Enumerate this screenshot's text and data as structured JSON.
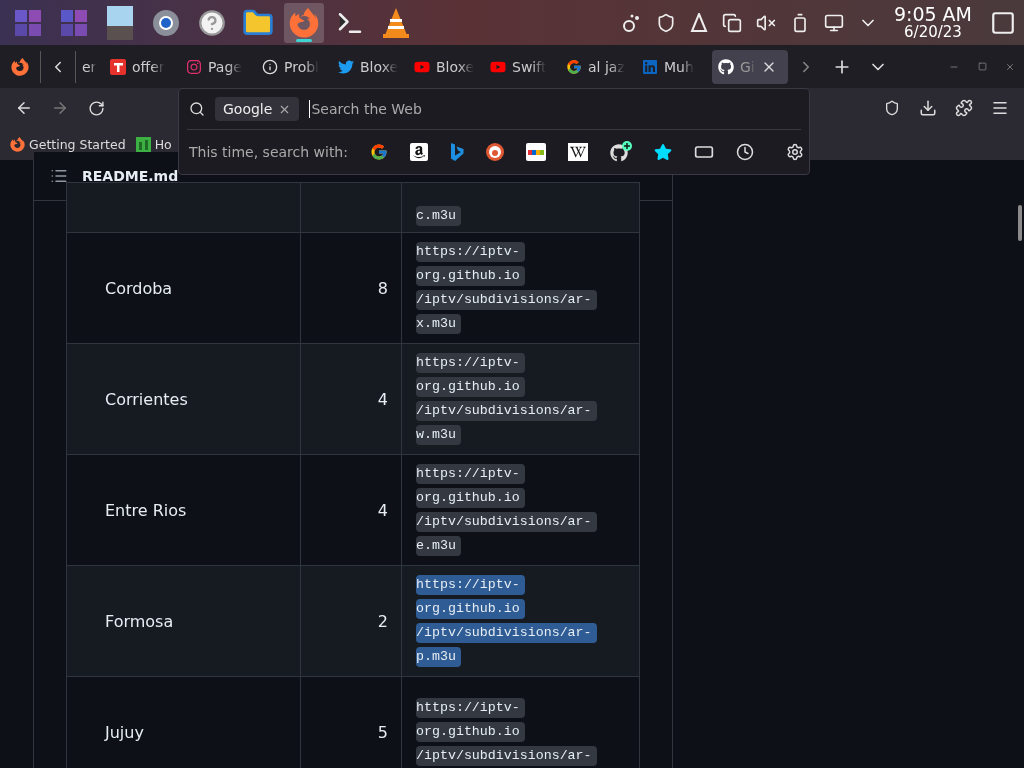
{
  "taskbar": {
    "apps": [
      {
        "active": false
      },
      {
        "active": false
      },
      {
        "active": false
      },
      {
        "active": false
      },
      {
        "active": false
      },
      {
        "active": false
      },
      {
        "active": true
      },
      {
        "active": false
      },
      {
        "active": false
      }
    ],
    "time": "9:05 AM",
    "date": "6/20/23"
  },
  "tabs": {
    "partial_label": "er",
    "items": [
      {
        "label": "offer",
        "selected": false
      },
      {
        "label": "Page",
        "selected": false
      },
      {
        "label": "Probl",
        "selected": false
      },
      {
        "label": "Bloxe",
        "selected": false
      },
      {
        "label": "Bloxe",
        "selected": false
      },
      {
        "label": "Swift",
        "selected": false
      },
      {
        "label": "al jaz",
        "selected": false
      },
      {
        "label": "Muh",
        "selected": false
      },
      {
        "label": "Gi",
        "selected": true
      }
    ]
  },
  "bookmarks": [
    "Getting Started",
    "Ho"
  ],
  "search": {
    "engine_chip": "Google",
    "placeholder": "Search the Web",
    "one_off_label": "This time, search with:"
  },
  "readme": {
    "title": "README.md",
    "rows": [
      {
        "name": "",
        "count": "",
        "url_lines": [
          "c.m3u"
        ],
        "selected": false
      },
      {
        "name": "Cordoba",
        "count": "8",
        "url_lines": [
          "https://iptv-",
          "org.github.io",
          "/iptv/subdivisions/ar-",
          "x.m3u"
        ],
        "selected": false
      },
      {
        "name": "Corrientes",
        "count": "4",
        "url_lines": [
          "https://iptv-",
          "org.github.io",
          "/iptv/subdivisions/ar-",
          "w.m3u"
        ],
        "selected": false
      },
      {
        "name": "Entre Rios",
        "count": "4",
        "url_lines": [
          "https://iptv-",
          "org.github.io",
          "/iptv/subdivisions/ar-",
          "e.m3u"
        ],
        "selected": false
      },
      {
        "name": "Formosa",
        "count": "2",
        "url_lines": [
          "https://iptv-",
          "org.github.io",
          "/iptv/subdivisions/ar-",
          "p.m3u"
        ],
        "selected": true
      },
      {
        "name": "Jujuy",
        "count": "5",
        "url_lines": [
          "https://iptv-",
          "org.github.io",
          "/iptv/subdivisions/ar-"
        ],
        "selected": false
      }
    ]
  }
}
